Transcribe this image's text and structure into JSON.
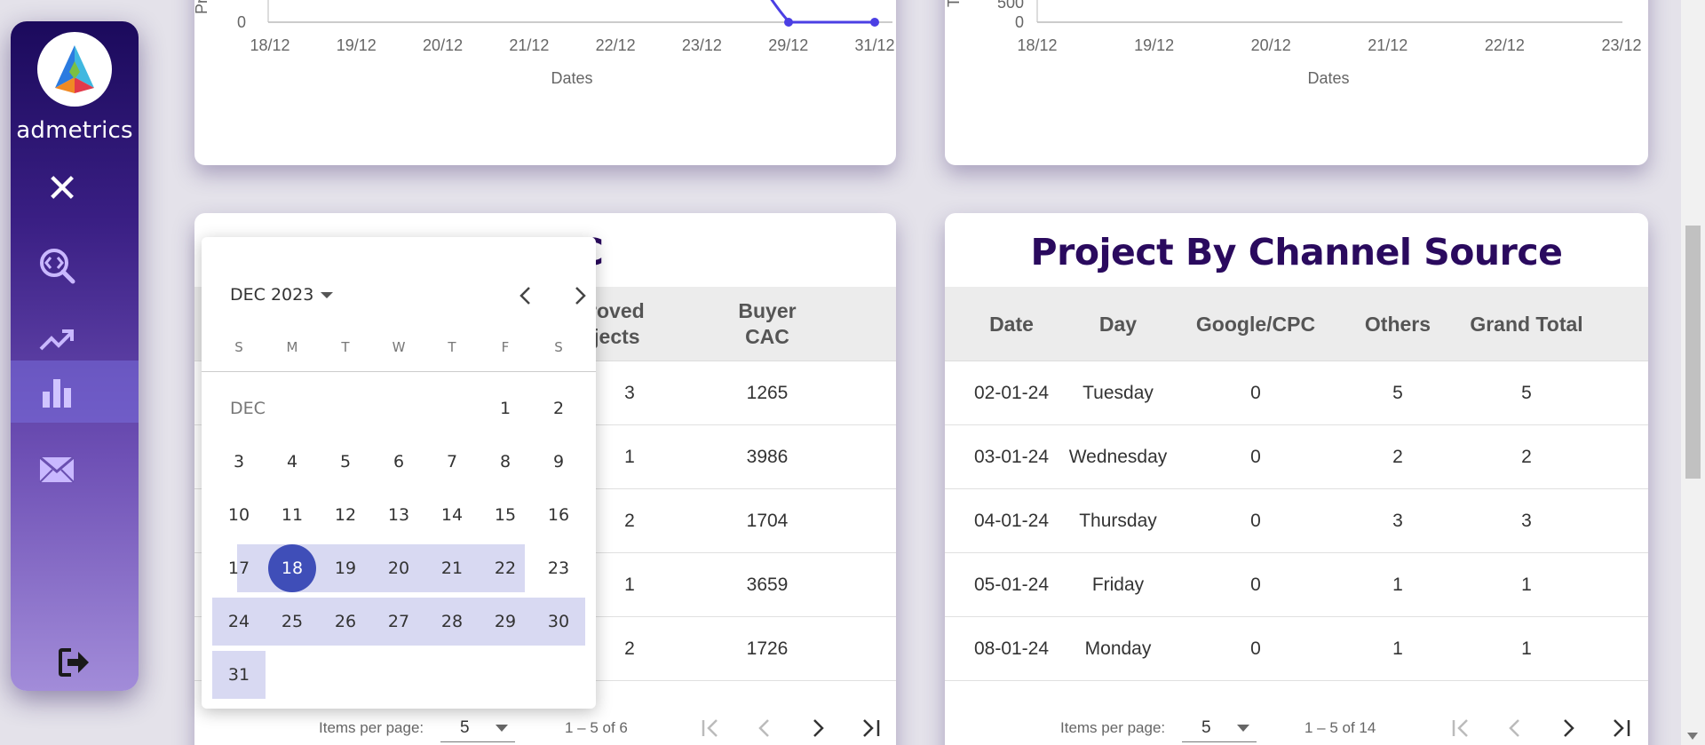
{
  "sidebar": {
    "brand": "admetrics",
    "items": [
      {
        "icon": "code-search-icon"
      },
      {
        "icon": "trending-up-icon"
      },
      {
        "icon": "bar-chart-icon",
        "active": true
      },
      {
        "icon": "mail-icon"
      }
    ],
    "close_icon": "close-icon",
    "logout_icon": "logout-icon"
  },
  "top_charts": [
    {
      "xlabel": "Dates",
      "ylabel_fragment": "Pr",
      "x_ticks": [
        "18/12",
        "19/12",
        "20/12",
        "21/12",
        "22/12",
        "23/12",
        "29/12",
        "31/12"
      ],
      "y_ticks_visible": [
        "0"
      ]
    },
    {
      "xlabel": "Dates",
      "ylabel_fragment": "T",
      "x_ticks": [
        "18/12",
        "19/12",
        "20/12",
        "21/12",
        "22/12",
        "23/12"
      ],
      "y_ticks_visible": [
        "500",
        "0"
      ]
    }
  ],
  "chart_data": [
    {
      "type": "line",
      "xlabel": "Dates",
      "x": [
        "18/12",
        "19/12",
        "20/12",
        "21/12",
        "22/12",
        "23/12",
        "29/12",
        "31/12"
      ],
      "series": [
        {
          "values_visible": {
            "29/12": 0,
            "31/12": 0
          }
        }
      ],
      "series_color": "#4b3fe4"
    },
    {
      "type": "line",
      "xlabel": "Dates",
      "x": [
        "18/12",
        "19/12",
        "20/12",
        "21/12",
        "22/12",
        "23/12"
      ]
    }
  ],
  "table_left": {
    "title_visible": "AC",
    "columns_visible": [
      "proved\nojects",
      "Buyer\nCAC"
    ],
    "rows": [
      [
        "3",
        "1265"
      ],
      [
        "1",
        "3986"
      ],
      [
        "2",
        "1704"
      ],
      [
        "1",
        "3659"
      ],
      [
        "2",
        "1726"
      ]
    ],
    "paginator": {
      "items_per_page_label": "Items per page:",
      "page_size": "5",
      "range": "1 – 5 of 6"
    }
  },
  "table_right": {
    "title": "Project By Channel Source",
    "columns": [
      "Date",
      "Day",
      "Google/CPC",
      "Others",
      "Grand Total"
    ],
    "rows": [
      [
        "02-01-24",
        "Tuesday",
        "0",
        "5",
        "5"
      ],
      [
        "03-01-24",
        "Wednesday",
        "0",
        "2",
        "2"
      ],
      [
        "04-01-24",
        "Thursday",
        "0",
        "3",
        "3"
      ],
      [
        "05-01-24",
        "Friday",
        "0",
        "1",
        "1"
      ],
      [
        "08-01-24",
        "Monday",
        "0",
        "1",
        "1"
      ]
    ],
    "paginator": {
      "items_per_page_label": "Items per page:",
      "page_size": "5",
      "range": "1 – 5 of 14"
    }
  },
  "datepicker": {
    "period_label": "DEC 2023",
    "month_label": "DEC",
    "weekdays": [
      "S",
      "M",
      "T",
      "W",
      "T",
      "F",
      "S"
    ],
    "weeks": [
      [
        "",
        "",
        "",
        "",
        "",
        "1",
        "2"
      ],
      [
        "3",
        "4",
        "5",
        "6",
        "7",
        "8",
        "9"
      ],
      [
        "10",
        "11",
        "12",
        "13",
        "14",
        "15",
        "16"
      ],
      [
        "17",
        "18",
        "19",
        "20",
        "21",
        "22",
        "23"
      ],
      [
        "24",
        "25",
        "26",
        "27",
        "28",
        "29",
        "30"
      ],
      [
        "31",
        "",
        "",
        "",
        "",
        "",
        ""
      ]
    ],
    "selected_start": "18",
    "range_highlight_color": "#d8d9f2",
    "selected_color": "#3f4eb8"
  },
  "colors": {
    "title": "#2a0a5e",
    "sidebar_top": "#1b0a5c",
    "sidebar_bottom": "#a28cd9"
  }
}
